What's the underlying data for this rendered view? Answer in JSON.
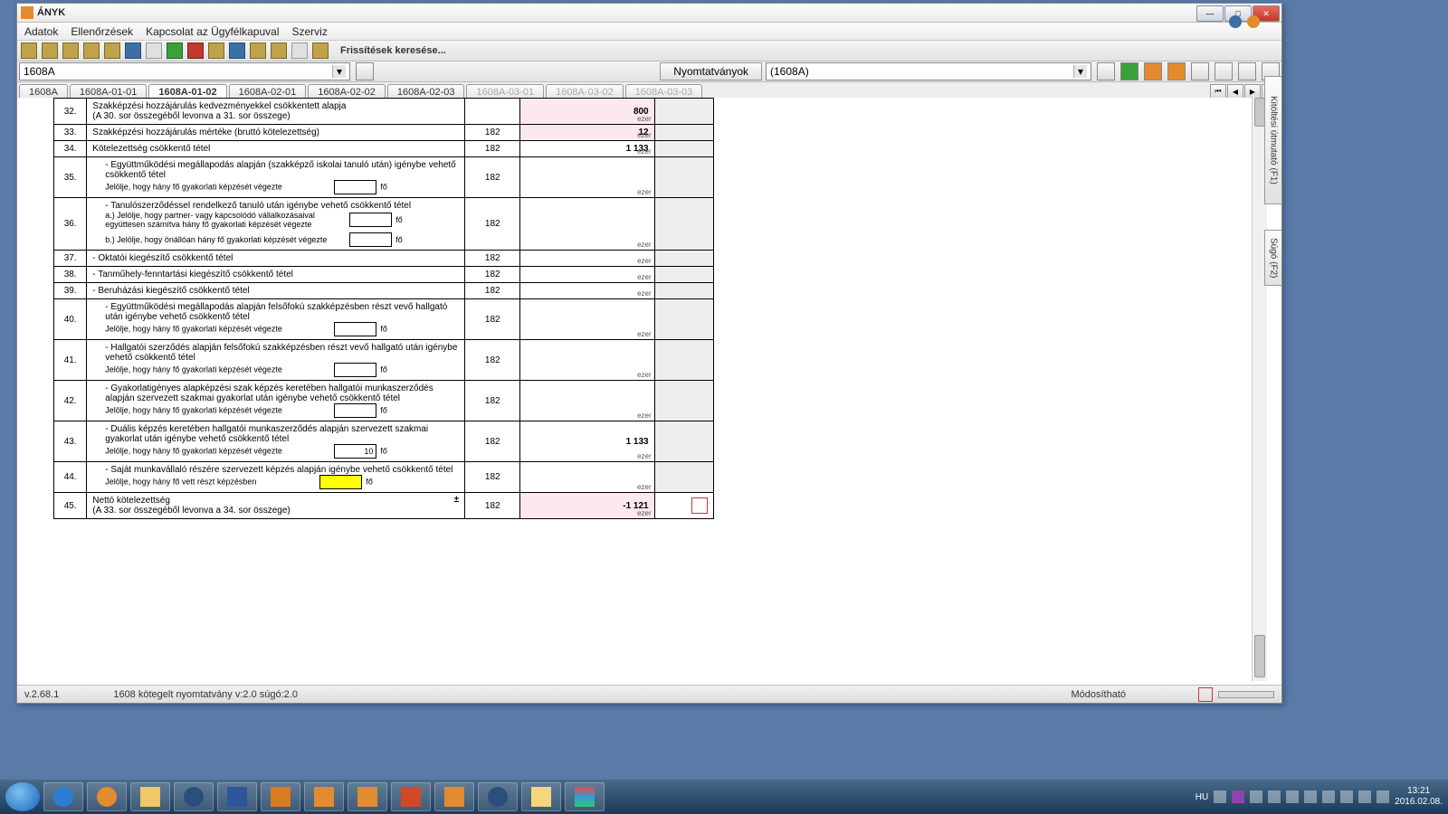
{
  "window": {
    "title": "ÁNYK"
  },
  "menu": [
    "Adatok",
    "Ellenőrzések",
    "Kapcsolat az Ügyfélkapuval",
    "Szerviz"
  ],
  "toolbar_text": "Frissítések keresése...",
  "combo_value": "1608A",
  "print_btn": "Nyomtatványok",
  "print_val": "(1608A)",
  "tabs": [
    {
      "label": "1608A",
      "sel": false,
      "dis": false
    },
    {
      "label": "1608A-01-01",
      "sel": false,
      "dis": false
    },
    {
      "label": "1608A-01-02",
      "sel": true,
      "dis": false
    },
    {
      "label": "1608A-02-01",
      "sel": false,
      "dis": false
    },
    {
      "label": "1608A-02-02",
      "sel": false,
      "dis": false
    },
    {
      "label": "1608A-02-03",
      "sel": false,
      "dis": false
    },
    {
      "label": "1608A-03-01",
      "sel": false,
      "dis": true
    },
    {
      "label": "1608A-03-02",
      "sel": false,
      "dis": true
    },
    {
      "label": "1608A-03-03",
      "sel": false,
      "dis": true
    }
  ],
  "side1": "Kitöltési útmutató (F1)",
  "side2": "Súgó (F2)",
  "unit": "ezer",
  "fo": "fő",
  "rows": {
    "r32": {
      "n": "32.",
      "d1": "Szakképzési hozzájárulás kedvezményekkel csökkentett alapja",
      "d2": "(A 30. sor összegéből levonva a 31. sor összege)",
      "num": "",
      "val": "800",
      "pink": true
    },
    "r33": {
      "n": "33.",
      "d": "Szakképzési hozzájárulás mértéke (bruttó kötelezettség)",
      "num": "182",
      "val": "12",
      "pink": true
    },
    "r34": {
      "n": "34.",
      "d": "Kötelezettség csökkentő tétel",
      "num": "182",
      "val": "1 133"
    },
    "r35": {
      "n": "35.",
      "d1": "- Együttműködési megállapodás alapján (szakképző iskolai tanuló után) igénybe vehető csökkentő tétel",
      "d2": "Jelölje, hogy hány fő gyakorlati képzését végezte",
      "num": "182",
      "inp": ""
    },
    "r36": {
      "n": "36.",
      "d1": "- Tanulószerződéssel rendelkező tanuló után igénybe vehető csökkentő tétel",
      "a": "a.) Jelölje, hogy partner- vagy kapcsolódó vállalkozásaival együttesen számítva hány fő gyakorlati képzését végezte",
      "b": "b.) Jelölje, hogy önállóan hány fő gyakorlati képzését végezte",
      "num": "182",
      "inpa": "",
      "inpb": ""
    },
    "r37": {
      "n": "37.",
      "d": "- Oktatói kiegészítő csökkentő tétel",
      "num": "182"
    },
    "r38": {
      "n": "38.",
      "d": "- Tanműhely-fenntartási kiegészítő csökkentő tétel",
      "num": "182"
    },
    "r39": {
      "n": "39.",
      "d": "- Beruházási kiegészítő csökkentő tétel",
      "num": "182"
    },
    "r40": {
      "n": "40.",
      "d1": "- Együttműködési megállapodás alapján felsőfokú szakképzésben részt vevő hallgató után igénybe vehető csökkentő tétel",
      "d2": "Jelölje, hogy hány fő gyakorlati képzését végezte",
      "num": "182",
      "inp": ""
    },
    "r41": {
      "n": "41.",
      "d1": "- Hallgatói szerződés alapján felsőfokú szakképzésben részt vevő hallgató után igénybe vehető csökkentő tétel",
      "d2": "Jelölje, hogy hány fő gyakorlati képzését végezte",
      "num": "182",
      "inp": ""
    },
    "r42": {
      "n": "42.",
      "d1": "- Gyakorlatigényes alapképzési szak képzés keretében hallgatói munkaszerződés alapján szervezett szakmai gyakorlat után igénybe vehető csökkentő tétel",
      "d2": "Jelölje, hogy hány fő gyakorlati képzését végezte",
      "num": "182",
      "inp": ""
    },
    "r43": {
      "n": "43.",
      "d1": "- Duális képzés keretében hallgatói munkaszerződés alapján szervezett szakmai gyakorlat után igénybe vehető csökkentő tétel",
      "d2": "Jelölje, hogy hány fő gyakorlati képzését végezte",
      "num": "182",
      "val": "1 133",
      "inp": "10"
    },
    "r44": {
      "n": "44.",
      "d1": "- Saját munkavállaló részére szervezett képzés alapján igénybe vehető csökkentő tétel",
      "d2": "Jelölje, hogy hány fő vett részt képzésben",
      "num": "182",
      "inp": "",
      "yel": true
    },
    "r45": {
      "n": "45.",
      "d1": "Nettó kötelezettség",
      "d2": "(A 33. sor összegéből levonva a 34. sor összege)",
      "num": "182",
      "val": "-1 121",
      "pink": true,
      "pm": "±"
    }
  },
  "status": {
    "left": "v.2.68.1",
    "mid": "1608 kötegelt nyomtatvány v:2.0 súgó:2.0",
    "right": "Módosítható"
  },
  "tray": {
    "lang": "HU",
    "time": "13:21",
    "date": "2016.02.08."
  }
}
